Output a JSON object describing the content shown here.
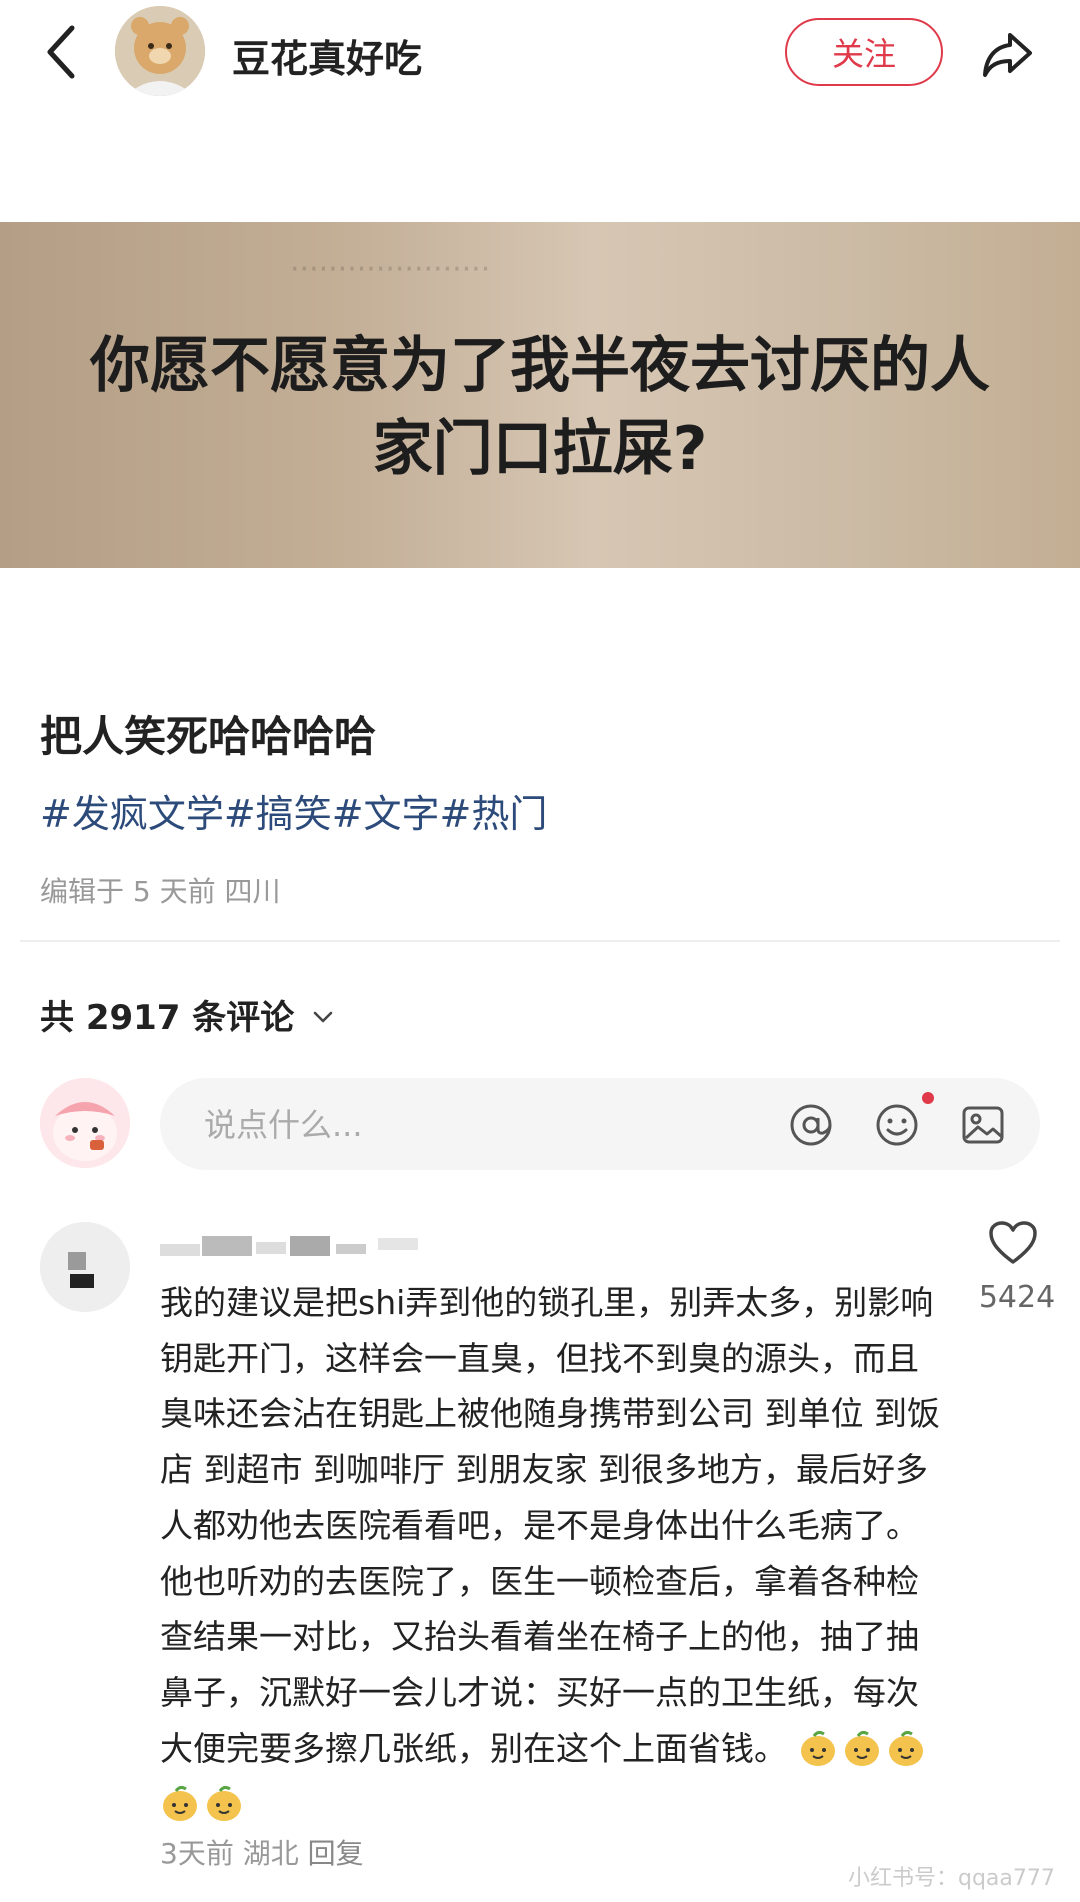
{
  "header": {
    "back_icon": "chevron-left-icon",
    "author_name": "豆花真好吃",
    "follow_label": "关注",
    "share_icon": "share-arrow-icon"
  },
  "post": {
    "image_text_line1": "你愿不愿意为了我半夜去讨厌的人",
    "image_text_line2": "家门口拉屎?",
    "title": "把人笑死哈哈哈哈",
    "tags": [
      "#发疯文学",
      "#搞笑",
      "#文字",
      "#热门"
    ],
    "meta": "编辑于 5 天前 四川"
  },
  "comments_header": {
    "label": "共 2917 条评论",
    "chevron_icon": "chevron-down-icon"
  },
  "comment_input": {
    "placeholder": "说点什么...",
    "icons": [
      "at-icon",
      "emoji-icon",
      "image-icon"
    ]
  },
  "comment": {
    "text": "我的建议是把shi弄到他的锁孔里，别弄太多，别影响钥匙开门，这样会一直臭，但找不到臭的源头，而且臭味还会沾在钥匙上被他随身携带到公司 到单位 到饭店  到超市 到咖啡厅 到朋友家 到很多地方，最后好多人都劝他去医院看看吧，是不是身体出什么毛病了。他也听劝的去医院了，医生一顿检查后，拿着各种检查结果一对比，又抬头看着坐在椅子上的他，抽了抽鼻子，沉默好一会儿才说：买好一点的卫生纸，每次大便完要多擦几张纸，别在这个上面省钱。",
    "emoji_count": 5,
    "like_icon": "heart-outline-icon",
    "likes": "5424",
    "time": "3天前",
    "location": "湖北",
    "reply_label": "回复"
  },
  "watermark": "小红书号：qqaa777",
  "colors": {
    "accent": "#e0394a",
    "tag_blue": "#2c4a7a",
    "meta_gray": "#999999"
  }
}
